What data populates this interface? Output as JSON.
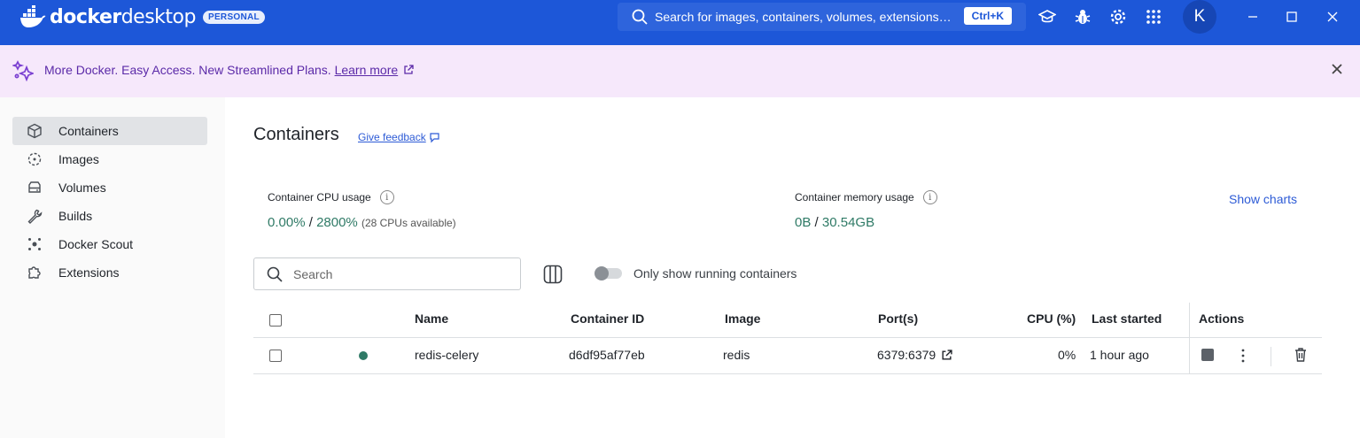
{
  "app": {
    "logo_word1": "docker",
    "logo_word2": "desktop",
    "plan_badge": "PERSONAL",
    "search_placeholder": "Search for images, containers, volumes, extensions…",
    "search_shortcut": "Ctrl+K",
    "avatar_initial": "K"
  },
  "banner": {
    "text": "More Docker. Easy Access. New Streamlined Plans.",
    "link": "Learn more"
  },
  "sidebar": {
    "items": [
      {
        "label": "Containers",
        "icon": "containers-icon"
      },
      {
        "label": "Images",
        "icon": "images-icon"
      },
      {
        "label": "Volumes",
        "icon": "volumes-icon"
      },
      {
        "label": "Builds",
        "icon": "builds-icon"
      },
      {
        "label": "Docker Scout",
        "icon": "scout-icon"
      },
      {
        "label": "Extensions",
        "icon": "extensions-icon"
      }
    ]
  },
  "main": {
    "title": "Containers",
    "feedback": "Give feedback",
    "cpu": {
      "label": "Container CPU usage",
      "used": "0.00%",
      "sep": " / ",
      "total": "2800%",
      "note": "(28 CPUs available)"
    },
    "memory": {
      "label": "Container memory usage",
      "used": "0B",
      "sep": " / ",
      "total": "30.54GB"
    },
    "show_charts": "Show charts",
    "search_placeholder": "Search",
    "toggle_label": "Only show running containers"
  },
  "table": {
    "headers": {
      "name": "Name",
      "id": "Container ID",
      "image": "Image",
      "ports": "Port(s)",
      "cpu": "CPU (%)",
      "last_started": "Last started",
      "actions": "Actions"
    },
    "rows": [
      {
        "name": "redis-celery",
        "id": "d6df95af77eb",
        "image": "redis",
        "ports": "6379:6379",
        "cpu": "0%",
        "last_started": "1 hour ago",
        "status": "running"
      }
    ]
  },
  "colors": {
    "brand": "#1d57d8",
    "banner_bg": "#f6e8fb",
    "running": "#2f7a66",
    "link": "#2d5bd6"
  }
}
